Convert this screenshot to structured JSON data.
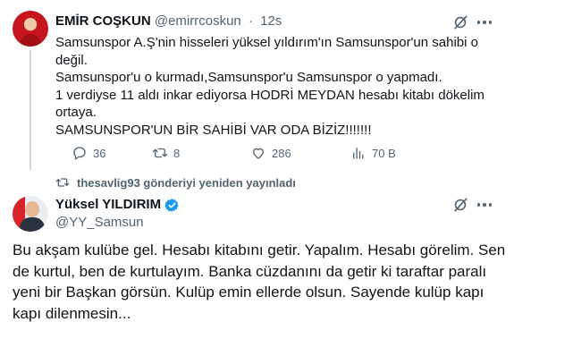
{
  "tweet1": {
    "name": "EMİR COŞKUN",
    "handle": "@emirrcoskun",
    "separator": "·",
    "time": "12s",
    "lines": [
      "Samsunspor A.Ş'nin hisseleri yüksel yıldırım'ın Samsunspor'un sahibi o",
      "değil.",
      "Samsunspor'u o kurmadı,Samsunspor'u Samsunspor o yapmadı.",
      "1 verdiyse 11 aldı inkar ediyorsa HODRİ MEYDAN hesabı kitabı dökelim",
      "ortaya.",
      "SAMSUNSPOR'UN BİR SAHİBİ VAR ODA BİZİZ!!!!!!!"
    ],
    "actions": {
      "replies": "36",
      "reposts": "8",
      "likes": "286",
      "views": "70 B"
    }
  },
  "repost": {
    "text": "thesavlig93 gönderiyi yeniden yayınladı"
  },
  "tweet2": {
    "name": "Yüksel YILDIRIM",
    "handle": "@YY_Samsun",
    "lines": [
      "Bu akşam kulübe gel. Hesabı kitabını getir. Yapalım. Hesabı görelim. Sen",
      "de kurtul, ben de kurtulayım. Banka cüzdanını da getir ki taraftar paralı",
      "yeni bir Başkan görsün. Kulüp emin ellerde olsun. Sayende kulüp kapı",
      "kapı dilenmesin..."
    ]
  },
  "colors": {
    "text": "#0f1419",
    "secondary": "#536471",
    "verified": "#1d9bf0",
    "thread_line": "#cfd9de"
  }
}
